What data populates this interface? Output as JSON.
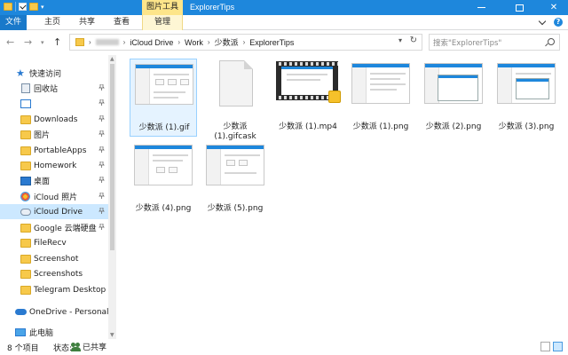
{
  "window": {
    "title": "ExplorerTips",
    "context_tab": "图片工具",
    "controls": [
      "minimize",
      "maximize",
      "close"
    ]
  },
  "ribbon": {
    "tabs": [
      {
        "label": "文件",
        "active": true
      },
      {
        "label": "主页"
      },
      {
        "label": "共享"
      },
      {
        "label": "查看"
      },
      {
        "label": "管理"
      }
    ],
    "help": "?"
  },
  "address": {
    "crumbs": [
      "iCloud Drive",
      "Work",
      "少数派",
      "ExplorerTips"
    ],
    "search_placeholder": "搜索\"ExplorerTips\""
  },
  "nav": {
    "items": [
      {
        "label": "快速访问",
        "icon": "star-icon",
        "pinned": false
      },
      {
        "label": "回收站",
        "icon": "recycle-bin-icon",
        "pinned": true
      },
      {
        "label": "",
        "icon": "image-icon",
        "pinned": true
      },
      {
        "label": "Downloads",
        "icon": "folder-icon",
        "pinned": true
      },
      {
        "label": "图片",
        "icon": "folder-icon",
        "pinned": true
      },
      {
        "label": "PortableApps",
        "icon": "folder-icon",
        "pinned": true
      },
      {
        "label": "Homework",
        "icon": "folder-icon",
        "pinned": true
      },
      {
        "label": "桌面",
        "icon": "desktop-icon",
        "pinned": true
      },
      {
        "label": "iCloud 照片",
        "icon": "icloud-photos-icon",
        "pinned": true
      },
      {
        "label": "iCloud Drive",
        "icon": "icloud-drive-icon",
        "pinned": true,
        "selected": true
      },
      {
        "label": "Google 云端硬盘",
        "icon": "google-drive-icon",
        "pinned": true
      },
      {
        "label": "FileRecv",
        "icon": "folder-icon",
        "pinned": false
      },
      {
        "label": "Screenshot",
        "icon": "folder-icon",
        "pinned": false
      },
      {
        "label": "Screenshots",
        "icon": "folder-icon",
        "pinned": false
      },
      {
        "label": "Telegram Desktop",
        "icon": "folder-icon",
        "pinned": false
      },
      {
        "label": "OneDrive - Personal",
        "icon": "onedrive-icon",
        "pinned": false
      },
      {
        "label": "此电脑",
        "icon": "pc-icon",
        "pinned": false
      }
    ]
  },
  "files": [
    {
      "name": "少数派 (1).gif",
      "kind": "screenshot",
      "selected": true
    },
    {
      "name": "少数派 (1).gifcask",
      "kind": "document"
    },
    {
      "name": "少数派 (1).mp4",
      "kind": "video"
    },
    {
      "name": "少数派 (1).png",
      "kind": "screenshot"
    },
    {
      "name": "少数派 (2).png",
      "kind": "screenshot"
    },
    {
      "name": "少数派 (3).png",
      "kind": "screenshot"
    },
    {
      "name": "少数派 (4).png",
      "kind": "screenshot"
    },
    {
      "name": "少数派 (5).png",
      "kind": "screenshot"
    }
  ],
  "status": {
    "count": "8 个项目",
    "state_label": "状态:",
    "share_label": "已共享"
  }
}
